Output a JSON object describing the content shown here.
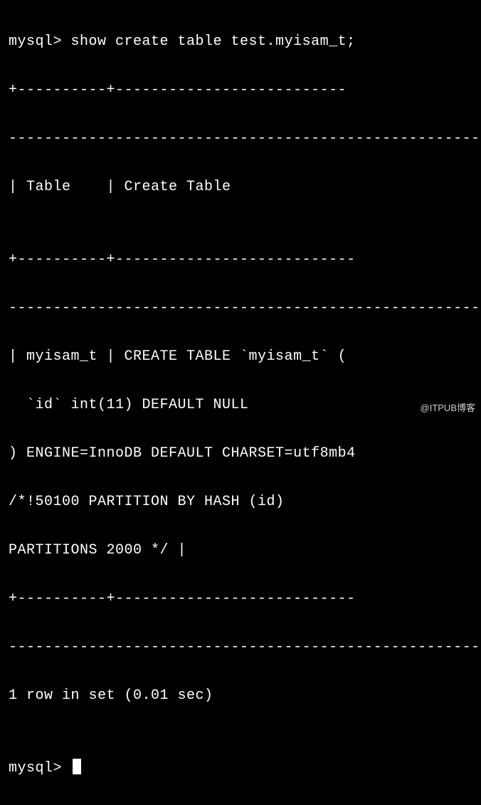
{
  "prompt1": "mysql> ",
  "command": "show create table test.myisam_t;",
  "sep_top1": "+----------+--------------------------",
  "sep_top2": "-------------------------------------------------------",
  "header_line": "| Table    | Create Table",
  "sep_mid1": "",
  "sep_mid2": "+----------+---------------------------",
  "sep_mid3": "-------------------------------------------------------",
  "row_l1": "| myisam_t | CREATE TABLE `myisam_t` (",
  "row_l2": "  `id` int(11) DEFAULT NULL",
  "row_l3": ") ENGINE=InnoDB DEFAULT CHARSET=utf8mb4",
  "row_l4": "/*!50100 PARTITION BY HASH (id)",
  "row_l5": "PARTITIONS 2000 */ |",
  "sep_bot1": "+----------+---------------------------",
  "sep_bot2": "-------------------------------------------------------",
  "result_msg": "1 row in set (0.01 sec)",
  "blank": "",
  "prompt2": "mysql> ",
  "watermark": "@ITPUB博客",
  "chart_data": {
    "type": "table",
    "columns": [
      "Table",
      "Create Table"
    ],
    "rows": [
      {
        "Table": "myisam_t",
        "Create Table": "CREATE TABLE `myisam_t` (\n  `id` int(11) DEFAULT NULL\n) ENGINE=InnoDB DEFAULT CHARSET=utf8mb4\n/*!50100 PARTITION BY HASH (id)\nPARTITIONS 2000 */"
      }
    ],
    "result_summary": "1 row in set (0.01 sec)"
  }
}
